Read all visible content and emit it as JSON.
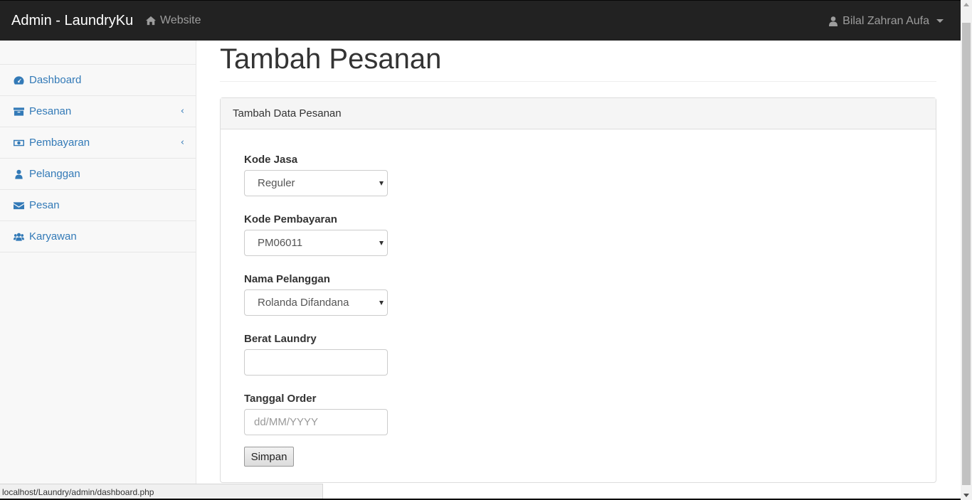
{
  "navbar": {
    "brand": "Admin - LaundryKu",
    "website_label": "Website",
    "user_name": "Bilal Zahran Aufa"
  },
  "sidebar": {
    "items": [
      {
        "label": "Dashboard",
        "icon": "dashboard-icon",
        "has_submenu": false
      },
      {
        "label": "Pesanan",
        "icon": "archive-icon",
        "has_submenu": true
      },
      {
        "label": "Pembayaran",
        "icon": "money-icon",
        "has_submenu": true
      },
      {
        "label": "Pelanggan",
        "icon": "user-icon",
        "has_submenu": false
      },
      {
        "label": "Pesan",
        "icon": "envelope-icon",
        "has_submenu": false
      },
      {
        "label": "Karyawan",
        "icon": "users-icon",
        "has_submenu": false
      }
    ]
  },
  "page": {
    "title": "Tambah Pesanan",
    "panel_heading": "Tambah Data Pesanan"
  },
  "form": {
    "kode_jasa": {
      "label": "Kode Jasa",
      "value": "Reguler"
    },
    "kode_pembayaran": {
      "label": "Kode Pembayaran",
      "value": "PM06011"
    },
    "nama_pelanggan": {
      "label": "Nama Pelanggan",
      "value": "Rolanda Difandana"
    },
    "berat_laundry": {
      "label": "Berat Laundry",
      "value": ""
    },
    "tanggal_order": {
      "label": "Tanggal Order",
      "placeholder": "dd/MM/YYYY"
    },
    "submit_label": "Simpan"
  },
  "statusbar": {
    "url": "localhost/Laundry/admin/dashboard.php"
  },
  "colors": {
    "navbar_bg": "#222222",
    "link": "#337ab7",
    "sidebar_bg": "#f8f8f8"
  }
}
